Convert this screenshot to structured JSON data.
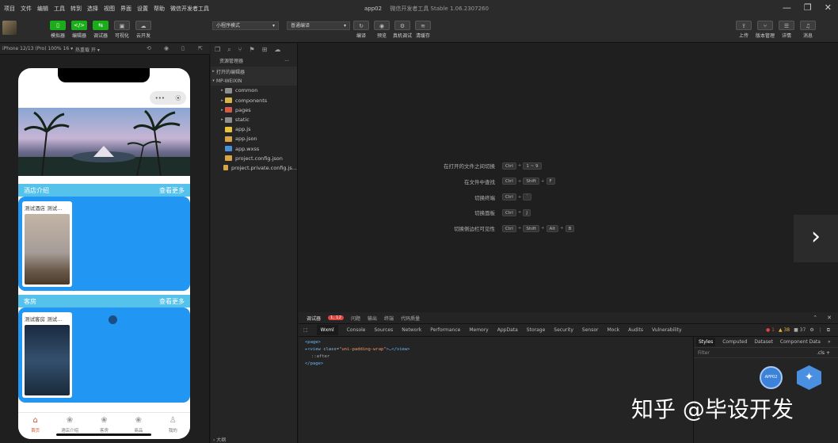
{
  "menu": {
    "items": [
      "项目",
      "文件",
      "编辑",
      "工具",
      "转到",
      "选择",
      "视图",
      "界面",
      "设置",
      "帮助",
      "微信开发者工具"
    ],
    "project_name": "app02",
    "app_title": "微信开发者工具 Stable 1.06.2307260"
  },
  "window_controls": {
    "minimize": "—",
    "maximize": "❐",
    "close": "✕"
  },
  "toolbar": {
    "left_buttons": [
      {
        "icon": "phone-icon",
        "glyph": "▯",
        "label": "模拟器",
        "active": true
      },
      {
        "icon": "code-icon",
        "glyph": "</>",
        "label": "编辑器",
        "active": true
      },
      {
        "icon": "debug-icon",
        "glyph": "⇆",
        "label": "调试器",
        "active": true
      },
      {
        "icon": "visual-icon",
        "glyph": "▣",
        "label": "可视化",
        "active": false
      },
      {
        "icon": "cloud-icon",
        "glyph": "☁",
        "label": "云开发",
        "active": false
      }
    ],
    "mode_select": "小程序模式",
    "compile_select": "普通编译",
    "mid_buttons": [
      {
        "icon": "refresh-icon",
        "glyph": "↻",
        "label": "编译"
      },
      {
        "icon": "eye-icon",
        "glyph": "◉",
        "label": "预览"
      },
      {
        "icon": "device-icon",
        "glyph": "⚙",
        "label": "真机调试"
      },
      {
        "icon": "layers-icon",
        "glyph": "≋",
        "label": "清缓存"
      }
    ],
    "right_buttons": [
      {
        "icon": "upload-icon",
        "glyph": "⇪",
        "label": "上传"
      },
      {
        "icon": "version-icon",
        "glyph": "⑂",
        "label": "版本管理"
      },
      {
        "icon": "details-icon",
        "glyph": "☰",
        "label": "详情"
      },
      {
        "icon": "bell-icon",
        "glyph": "♫",
        "label": "消息"
      }
    ]
  },
  "simulator": {
    "device": "iPhone 12/13 (Pro) 100% 16 ▾",
    "hot_reload": "热重载 开 ▾",
    "capsule_dots": "•••",
    "capsule_close": "⦿",
    "sections": [
      {
        "title": "酒店介绍",
        "more": "查看更多",
        "card_title": "测试酒店 测试..."
      },
      {
        "title": "客房",
        "more": "查看更多",
        "card_title": "测试客房 测试..."
      }
    ],
    "tabs": [
      {
        "label": "首页",
        "glyph": "⌂",
        "active": true
      },
      {
        "label": "酒店介绍",
        "glyph": "❀",
        "active": false
      },
      {
        "label": "客房",
        "glyph": "❀",
        "active": false
      },
      {
        "label": "商品",
        "glyph": "❀",
        "active": false
      },
      {
        "label": "我的",
        "glyph": "♙",
        "active": false
      }
    ]
  },
  "explorer": {
    "header": "资源管理器",
    "more": "···",
    "open_editors": "打开的编辑器",
    "project": "MP-WEIXIN",
    "items": [
      {
        "name": "common",
        "type": "folder",
        "color": "#8e8e8e"
      },
      {
        "name": "components",
        "type": "folder",
        "color": "#d8b54a"
      },
      {
        "name": "pages",
        "type": "folder",
        "color": "#d45a4a"
      },
      {
        "name": "static",
        "type": "folder",
        "color": "#8e8e8e"
      },
      {
        "name": "app.js",
        "type": "file",
        "color": "#e6c33a"
      },
      {
        "name": "app.json",
        "type": "file",
        "color": "#d9a34a"
      },
      {
        "name": "app.wxss",
        "type": "file",
        "color": "#4a8fd9"
      },
      {
        "name": "project.config.json",
        "type": "file",
        "color": "#d9a34a"
      },
      {
        "name": "project.private.config.js...",
        "type": "file",
        "color": "#d9a34a"
      }
    ],
    "outline": "› 大纲"
  },
  "shortcuts": [
    {
      "label": "在打开的文件之间切换",
      "keys": [
        "Ctrl",
        "1 ~ 9"
      ]
    },
    {
      "label": "在文件中查找",
      "keys": [
        "Ctrl",
        "Shift",
        "F"
      ]
    },
    {
      "label": "切换终端",
      "keys": [
        "Ctrl",
        "`"
      ]
    },
    {
      "label": "切换面板",
      "keys": [
        "Ctrl",
        "J"
      ]
    },
    {
      "label": "切换侧边栏可见性",
      "keys": [
        "Ctrl",
        "Shift",
        "Alt",
        "B"
      ]
    }
  ],
  "debugger": {
    "top_tabs": [
      "调试器",
      "问题",
      "输出",
      "终端",
      "代码质量"
    ],
    "error_badge": "1, 12",
    "tabs": [
      "Wxml",
      "Console",
      "Sources",
      "Network",
      "Performance",
      "Memory",
      "AppData",
      "Storage",
      "Security",
      "Sensor",
      "Mock",
      "Audits",
      "Vulnerability"
    ],
    "status": {
      "errors": "● 1",
      "warnings": "▲ 38",
      "info": "■ 37"
    },
    "dom": {
      "line1": "<page>",
      "line2_open": "▸<view ",
      "attr_name": "class=",
      "attr_val": "\"uni-padding-wrap\"",
      "line2_close": ">…</view>",
      "line3": "::after",
      "line4": "</page>"
    },
    "styles_tabs": [
      "Styles",
      "Computed",
      "Dataset",
      "Component Data",
      "»"
    ],
    "filter": "Filter",
    "cls": ".cls  +"
  },
  "watermark": {
    "text": "知乎 @毕设开发",
    "logo_text": "APP02"
  }
}
